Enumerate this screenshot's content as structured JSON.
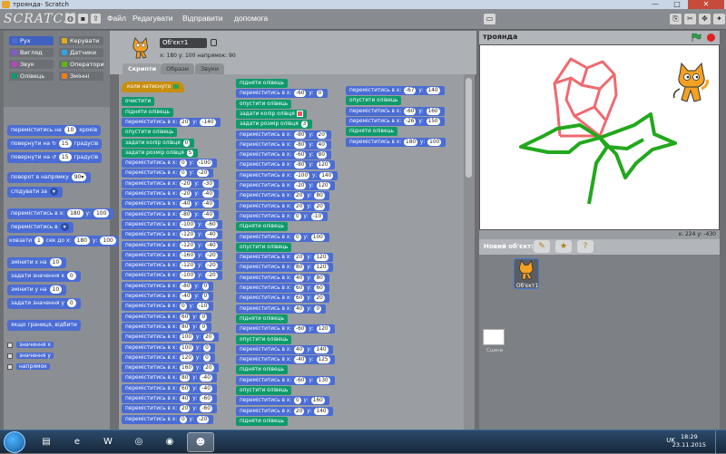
{
  "window": {
    "title": "троянда- Scratch",
    "buttons": [
      "—",
      "□",
      "✕"
    ]
  },
  "menubar": {
    "logo": "SCRATCH",
    "menus": [
      "Файл",
      "Редагувати",
      "Відправити",
      "допомога"
    ]
  },
  "categories": [
    {
      "label": "Рух",
      "color": "#4a6cd4",
      "selected": true
    },
    {
      "label": "Керувати",
      "color": "#e1a91a"
    },
    {
      "label": "Вигляд",
      "color": "#8a55d7"
    },
    {
      "label": "Датчики",
      "color": "#2ca5e2"
    },
    {
      "label": "Звук",
      "color": "#bb42c3"
    },
    {
      "label": "Оператори",
      "color": "#5cb712"
    },
    {
      "label": "Олівець",
      "color": "#0e9a6c"
    },
    {
      "label": "Змінні",
      "color": "#ee7d16"
    }
  ],
  "palette": {
    "move": {
      "a": "переміститись на",
      "v": "10",
      "b": "кроків"
    },
    "turn_right": {
      "a": "повернути на",
      "icon": "↻",
      "v": "15",
      "b": "градусів"
    },
    "turn_left": {
      "a": "повернути на",
      "icon": "↺",
      "v": "15",
      "b": "градусів"
    },
    "point_dir": {
      "a": "поворот в напрямку",
      "v": "90▾"
    },
    "point_to": {
      "a": "слідувати за",
      "v": "▾"
    },
    "goto_xy": {
      "a": "переміститись в х:",
      "x": "180",
      "b": "у:",
      "y": "100"
    },
    "goto": {
      "a": "переміститись в",
      "v": "▾"
    },
    "glide": {
      "a": "ковзати",
      "v": "1",
      "b": "сек до х:",
      "x": "180",
      "c": "у:",
      "y": "100"
    },
    "change_x": {
      "a": "змінити х на",
      "v": "10"
    },
    "set_x": {
      "a": "задати значення х",
      "v": "0"
    },
    "change_y": {
      "a": "змінити у на",
      "v": "10"
    },
    "set_y": {
      "a": "задати значення у",
      "v": "0"
    },
    "bounce": {
      "a": "якщо границя, відбити"
    },
    "rep_x": "значення х",
    "rep_y": "значення у",
    "rep_dir": "напрямок"
  },
  "sprite": {
    "name": "Об'єкт1",
    "x_label": "x:",
    "x": "180",
    "y_label": "y:",
    "y": "100",
    "dir_label": "напрямок:",
    "dir": "90"
  },
  "tabs": [
    "Скрипти",
    "Образи",
    "Звуки"
  ],
  "scripts": {
    "col1": [
      {
        "t": "ev",
        "text": "коли натиснуто"
      },
      {
        "t": "pen",
        "text": "очистити"
      },
      {
        "t": "pen",
        "text": "підняти олівець"
      },
      {
        "t": "m",
        "x": "20",
        "y": "-140"
      },
      {
        "t": "pen",
        "text": "опустити олівець"
      },
      {
        "t": "pen",
        "text": "задати колір олівця",
        "v": "0"
      },
      {
        "t": "pen",
        "text": "задати розмір олівця",
        "v": "5"
      },
      {
        "t": "m",
        "x": "0",
        "y": "-100"
      },
      {
        "t": "m",
        "x": "0",
        "y": "-20"
      },
      {
        "t": "m",
        "x": "-20",
        "y": "-30"
      },
      {
        "t": "m",
        "x": "-20",
        "y": "-40"
      },
      {
        "t": "m",
        "x": "-40",
        "y": "-40"
      },
      {
        "t": "m",
        "x": "-80",
        "y": "-40"
      },
      {
        "t": "m",
        "x": "-100",
        "y": "-60"
      },
      {
        "t": "m",
        "x": "-120",
        "y": "-40"
      },
      {
        "t": "m",
        "x": "-120",
        "y": "-40"
      },
      {
        "t": "m",
        "x": "-160",
        "y": "-20"
      },
      {
        "t": "m",
        "x": "-120",
        "y": "-20"
      },
      {
        "t": "m",
        "x": "-100",
        "y": "-20"
      },
      {
        "t": "m",
        "x": "-80",
        "y": "0"
      },
      {
        "t": "m",
        "x": "-40",
        "y": "0"
      },
      {
        "t": "m",
        "x": "0",
        "y": "-10"
      },
      {
        "t": "m",
        "x": "60",
        "y": "0"
      },
      {
        "t": "m",
        "x": "80",
        "y": "0"
      },
      {
        "t": "m",
        "x": "100",
        "y": "20"
      },
      {
        "t": "m",
        "x": "100",
        "y": "0"
      },
      {
        "t": "m",
        "x": "120",
        "y": "0"
      },
      {
        "t": "m",
        "x": "160",
        "y": "20"
      },
      {
        "t": "m",
        "x": "80",
        "y": "-40"
      },
      {
        "t": "m",
        "x": "60",
        "y": "-40"
      },
      {
        "t": "m",
        "x": "40",
        "y": "-60"
      },
      {
        "t": "m",
        "x": "20",
        "y": "-60"
      },
      {
        "t": "m",
        "x": "0",
        "y": "-20"
      }
    ],
    "col2": [
      {
        "t": "pen",
        "text": "підняти олівець"
      },
      {
        "t": "m",
        "x": "-60",
        "y": "0"
      },
      {
        "t": "pen",
        "text": "опустити олівець"
      },
      {
        "t": "pen",
        "text": "задати колір олівця",
        "sw": "#ff4f5a"
      },
      {
        "t": "pen",
        "text": "задати розмір олівця",
        "v": "3"
      },
      {
        "t": "m",
        "x": "-80",
        "y": "20"
      },
      {
        "t": "m",
        "x": "-80",
        "y": "40"
      },
      {
        "t": "m",
        "x": "-60",
        "y": "80"
      },
      {
        "t": "m",
        "x": "-80",
        "y": "120"
      },
      {
        "t": "m",
        "x": "-100",
        "y": "140"
      },
      {
        "t": "m",
        "x": "-20",
        "y": "120"
      },
      {
        "t": "m",
        "x": "20",
        "y": "80"
      },
      {
        "t": "m",
        "x": "20",
        "y": "20"
      },
      {
        "t": "m",
        "x": "0",
        "y": "-10"
      },
      {
        "t": "pen",
        "text": "підняти олівець"
      },
      {
        "t": "m",
        "x": "0",
        "y": "100"
      },
      {
        "t": "pen",
        "text": "опустити олівець"
      },
      {
        "t": "m",
        "x": "20",
        "y": "120"
      },
      {
        "t": "m",
        "x": "80",
        "y": "120"
      },
      {
        "t": "m",
        "x": "40",
        "y": "80"
      },
      {
        "t": "m",
        "x": "60",
        "y": "60"
      },
      {
        "t": "m",
        "x": "60",
        "y": "20"
      },
      {
        "t": "m",
        "x": "40",
        "y": "0"
      },
      {
        "t": "pen",
        "text": "підняти олівець"
      },
      {
        "t": "m",
        "x": "-60",
        "y": "120"
      },
      {
        "t": "pen",
        "text": "опустити олівець"
      },
      {
        "t": "m",
        "x": "40",
        "y": "140"
      },
      {
        "t": "m",
        "x": "-40",
        "y": "125"
      },
      {
        "t": "pen",
        "text": "підняти олівець"
      },
      {
        "t": "m",
        "x": "-60",
        "y": "130"
      },
      {
        "t": "pen",
        "text": "опустити олівець"
      },
      {
        "t": "m",
        "x": "0",
        "y": "160"
      },
      {
        "t": "m",
        "x": "20",
        "y": "140"
      },
      {
        "t": "pen",
        "text": "підняти олівець"
      }
    ],
    "col3": [
      {
        "t": "m",
        "x": "-67",
        "y": "140"
      },
      {
        "t": "pen",
        "text": "опустити олівець"
      },
      {
        "t": "m",
        "x": "-60",
        "y": "160"
      },
      {
        "t": "m",
        "x": "-26",
        "y": "150"
      },
      {
        "t": "pen",
        "text": "підняти олівець"
      },
      {
        "t": "m",
        "x": "180",
        "y": "100"
      }
    ],
    "move_prefix": "переміститись в х:",
    "move_y": "у:"
  },
  "stage": {
    "title": "троянда",
    "pointer": "x: 224   y: -430",
    "colors": {
      "petal": "#ef6a6e",
      "leaf": "#22a81c"
    }
  },
  "new_sprite": {
    "label": "Новий об'єкт:"
  },
  "sprite_list": {
    "sprite_label": "Об'єкт1",
    "stage_label": "Сцена"
  },
  "taskbar": {
    "lang": "UK",
    "time": "18:29",
    "date": "23.11.2015"
  }
}
